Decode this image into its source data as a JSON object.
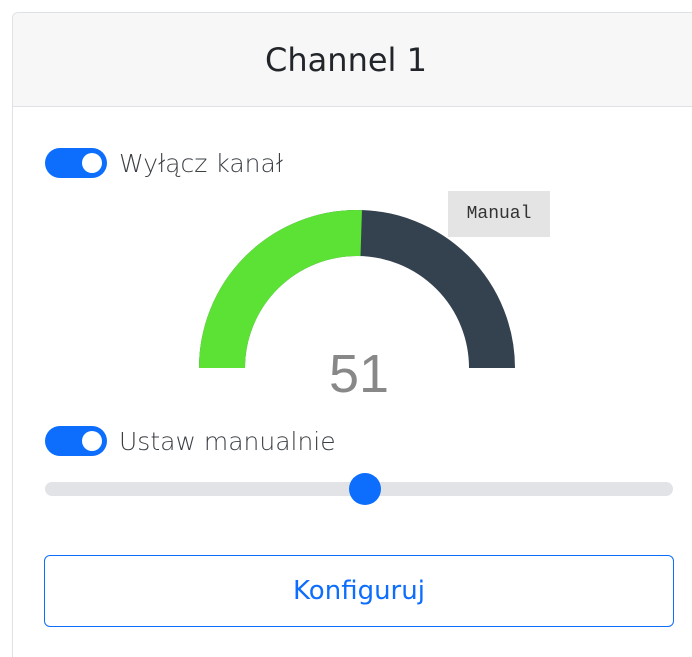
{
  "card": {
    "title": "Channel 1"
  },
  "toggles": [
    {
      "label": "Wyłącz kanał",
      "checked": true
    },
    {
      "label": "Ustaw manualnie",
      "checked": true
    }
  ],
  "gauge": {
    "value": "51",
    "mode": "Manual",
    "fill_fraction": 0.51,
    "colors": {
      "active": "#5ce135",
      "inactive": "#34414f"
    }
  },
  "slider": {
    "value_fraction": 0.51
  },
  "button": {
    "label": "Konfiguruj"
  },
  "colors": {
    "accent": "#0d6efd",
    "header_bg": "#f7f7f7"
  }
}
